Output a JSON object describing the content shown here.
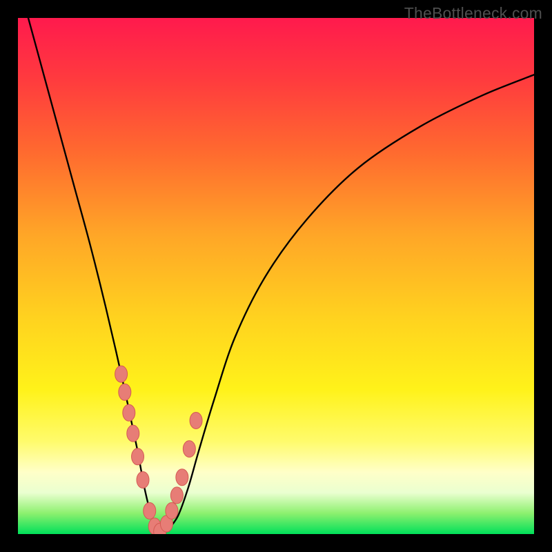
{
  "watermark": "TheBottleneck.com",
  "colors": {
    "background_frame": "#000000",
    "curve_stroke": "#000000",
    "marker_fill": "#e77d76",
    "marker_stroke": "#d45a53",
    "gradient_top": "#ff1a4d",
    "gradient_bottom": "#00e05a"
  },
  "chart_data": {
    "type": "line",
    "title": "",
    "xlabel": "",
    "ylabel": "",
    "xlim": [
      0,
      100
    ],
    "ylim": [
      0,
      100
    ],
    "grid": false,
    "legend": false,
    "series": [
      {
        "name": "bottleneck-curve",
        "x": [
          2,
          5,
          8,
          11,
          14,
          17,
          20,
          23,
          24.5,
          26,
          27,
          28,
          29,
          31,
          33,
          35,
          38,
          42,
          48,
          56,
          66,
          78,
          90,
          100
        ],
        "values": [
          100,
          89,
          78,
          67,
          56,
          44,
          31,
          17,
          9,
          3,
          0.8,
          0,
          0.8,
          3.5,
          9,
          16,
          26,
          38,
          50,
          61,
          71,
          79,
          85,
          89
        ]
      }
    ],
    "markers": {
      "name": "highlighted-points",
      "x": [
        20.0,
        20.7,
        21.5,
        22.3,
        23.2,
        24.2,
        25.5,
        26.5,
        27.5,
        28.8,
        29.8,
        30.8,
        31.8,
        33.2,
        34.5
      ],
      "values": [
        31.0,
        27.5,
        23.5,
        19.5,
        15.0,
        10.5,
        4.5,
        1.5,
        0.5,
        2.0,
        4.5,
        7.5,
        11.0,
        16.5,
        22.0
      ]
    }
  }
}
